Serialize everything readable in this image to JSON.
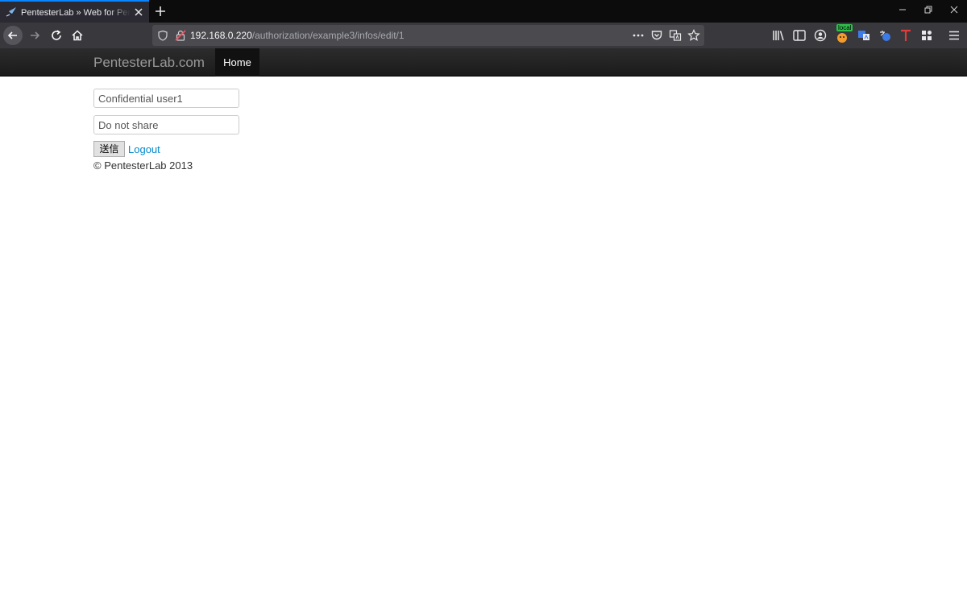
{
  "browser": {
    "tab_title": "PentesterLab » Web for Pentester",
    "url_host": "192.168.0.220",
    "url_path": "/authorization/example3/infos/edit/1",
    "extension_badge": "local"
  },
  "site": {
    "brand": "PentesterLab.com",
    "nav_home": "Home"
  },
  "form": {
    "field1_value": "Confidential user1",
    "field2_value": "Do not share",
    "submit_label": "送信",
    "logout_label": "Logout"
  },
  "footer": {
    "copyright": "© PentesterLab 2013"
  },
  "colors": {
    "tab_accent": "#0a84ff",
    "link": "#0088cc",
    "navbar": "#1b1b1b"
  }
}
